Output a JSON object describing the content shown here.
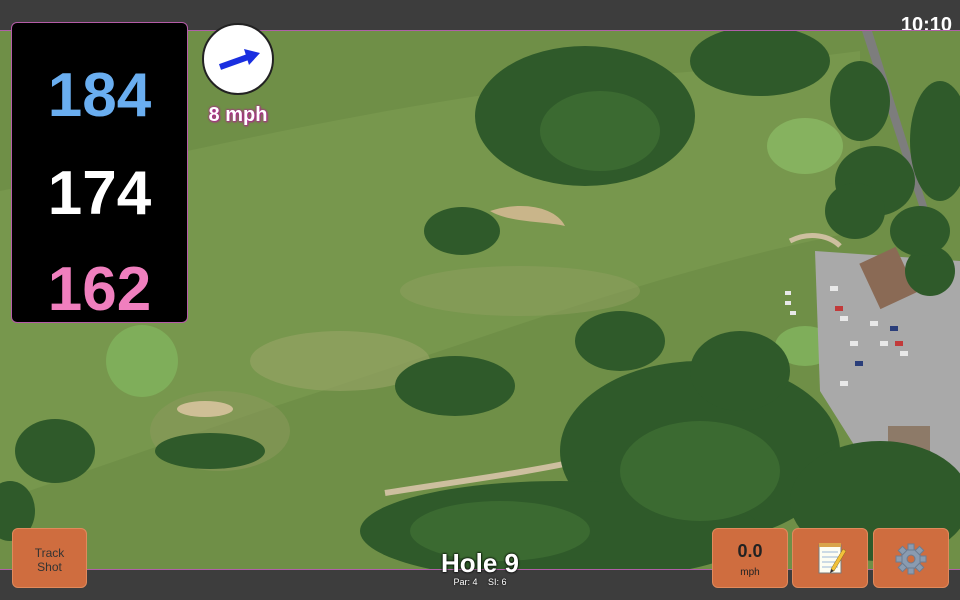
{
  "status": {
    "time": "10:10"
  },
  "yardage": {
    "back": "184",
    "middle": "174",
    "front": "162"
  },
  "wind": {
    "speed": "8 mph",
    "direction_icon": "wind-arrow-icon"
  },
  "buttons": {
    "track_shot_line1": "Track",
    "track_shot_line2": "Shot",
    "speed_value": "0.0",
    "speed_unit": "mph",
    "notes_icon": "notepad-icon",
    "settings_icon": "gear-icon"
  },
  "hole": {
    "title": "Hole 9",
    "par": "Par: 4",
    "si": "SI: 6"
  },
  "colors": {
    "back": "#6aaef0",
    "middle": "#ffffff",
    "front": "#f07fbe",
    "button": "#cf6d3f",
    "accent_border": "#b55ca8",
    "arrow": "#1a2fe0"
  }
}
